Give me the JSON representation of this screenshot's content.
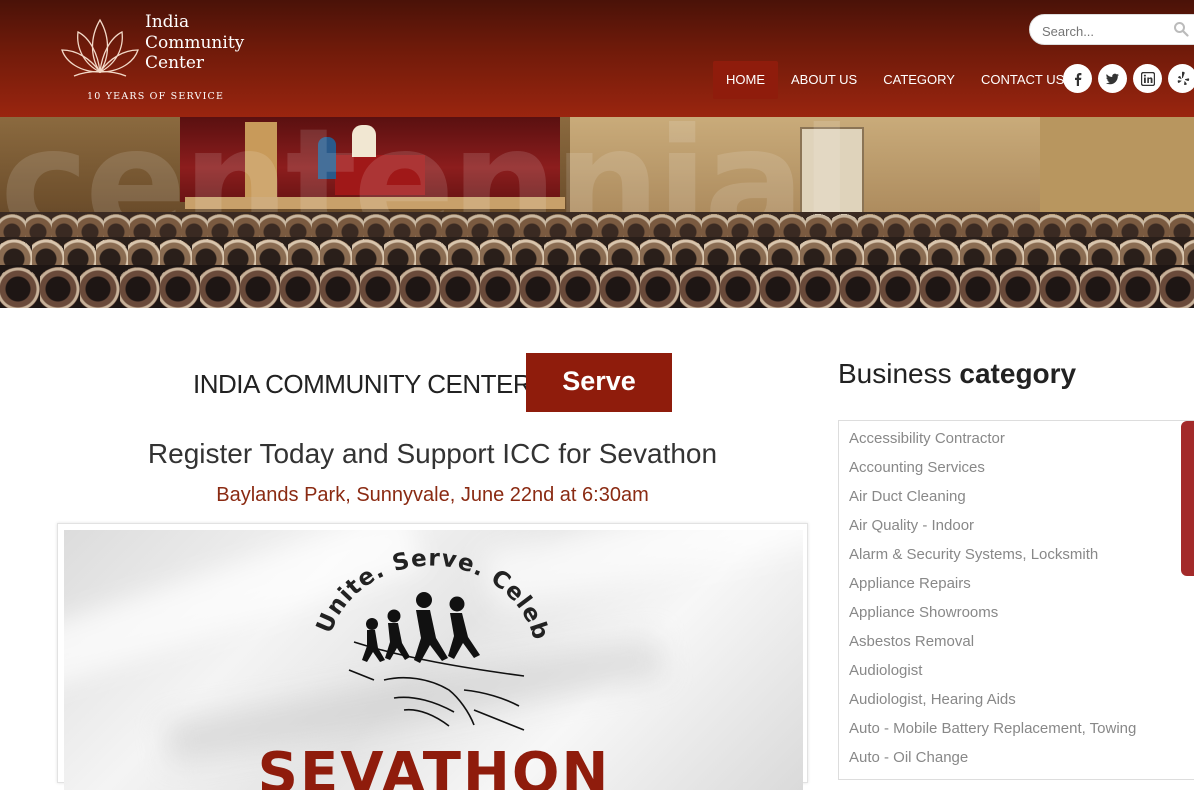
{
  "header": {
    "logo": {
      "line1": "India",
      "line2": "Community",
      "line3": "Center",
      "tagline": "10 YEARS OF SERVICE"
    },
    "search": {
      "placeholder": "Search..."
    },
    "nav": [
      {
        "label": "HOME",
        "active": true
      },
      {
        "label": "ABOUT US"
      },
      {
        "label": "CATEGORY"
      },
      {
        "label": "CONTACT US"
      }
    ],
    "social": [
      "facebook-icon",
      "twitter-icon",
      "linkedin-icon",
      "yelp-icon"
    ]
  },
  "main": {
    "title": "INDIA COMMUNITY CENTER",
    "title_highlight": "Serve",
    "headline": "Register Today and Support ICC for Sevathon",
    "location": "Baylands Park, Sunnyvale, June 22nd at 6:30am",
    "poster": {
      "arc_text": "Unite. Serve. Celebrate.",
      "wordmark": "SEVATHON"
    }
  },
  "sidebar": {
    "title_light": "Business",
    "title_bold": "category",
    "categories": [
      "Accessibility Contractor",
      "Accounting Services",
      "Air Duct Cleaning",
      "Air Quality - Indoor",
      "Alarm & Security Systems, Locksmith",
      "Appliance Repairs",
      "Appliance Showrooms",
      "Asbestos Removal",
      "Audiologist",
      "Audiologist, Hearing Aids",
      "Auto - Mobile Battery Replacement, Towing",
      "Auto - Oil Change"
    ]
  },
  "colors": {
    "brand": "#8f1c0c",
    "header_top": "#4a1208",
    "location_text": "#8a2a12",
    "category_text": "#888888"
  }
}
